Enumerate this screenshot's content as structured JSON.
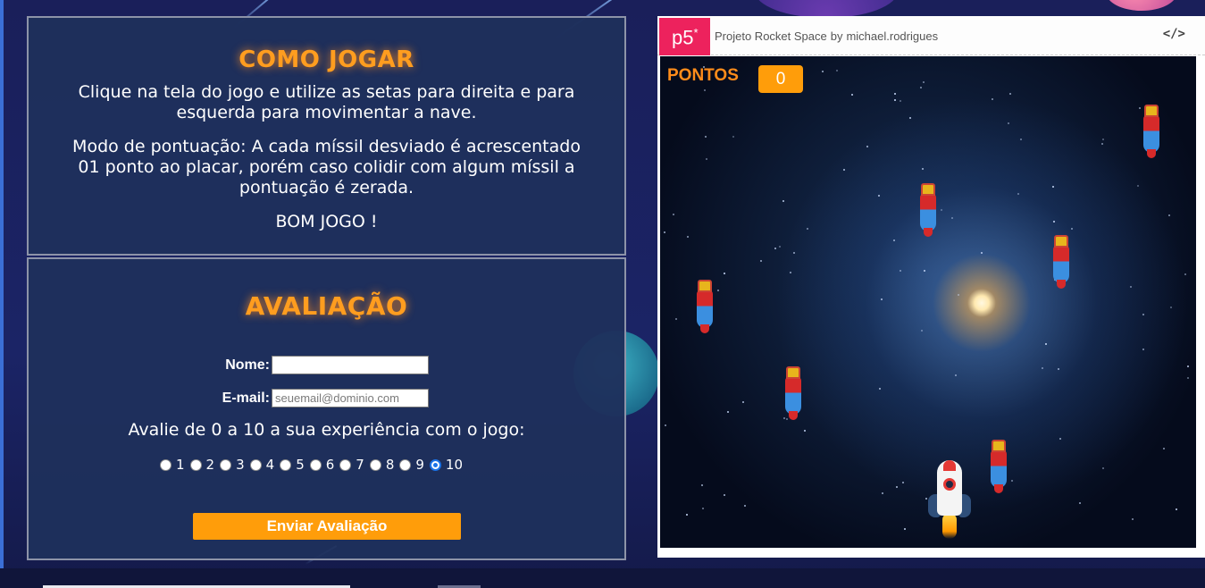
{
  "how_to_play": {
    "title": "COMO JOGAR",
    "paragraph_1": "Clique na tela do jogo e utilize as setas para direita e para esquerda para movimentar a nave.",
    "paragraph_2": "Modo de pontuação: A cada míssil desviado é acrescentado 01 ponto ao placar, porém caso colidir com algum míssil a pontuação é zerada.",
    "paragraph_3": "BOM JOGO !"
  },
  "evaluation": {
    "title": "AVALIAÇÃO",
    "name_label": "Nome:",
    "name_value": "",
    "email_label": "E-mail:",
    "email_placeholder": "seuemail@dominio.com",
    "rating_question": "Avalie de 0 a 10 a sua experiência com o jogo:",
    "rating_options": [
      "1",
      "2",
      "3",
      "4",
      "5",
      "6",
      "7",
      "8",
      "9",
      "10"
    ],
    "rating_selected": "10",
    "submit_label": "Enviar Avaliação"
  },
  "embed": {
    "logo": "p5",
    "logo_mark": "*",
    "project_title": "Projeto Rocket Space",
    "by": "by",
    "author": "michael.rodrigues",
    "code_icon": "</>"
  },
  "game": {
    "score_label": "PONTOS",
    "score_value": "0",
    "missile_icon": "missile-icon",
    "rocket_icon": "rocket-icon"
  },
  "colors": {
    "accent_orange": "#ff9d0a",
    "panel_bg": "#1e305c",
    "p5_pink": "#ed225d",
    "radio_selected": "#1a73e8"
  }
}
